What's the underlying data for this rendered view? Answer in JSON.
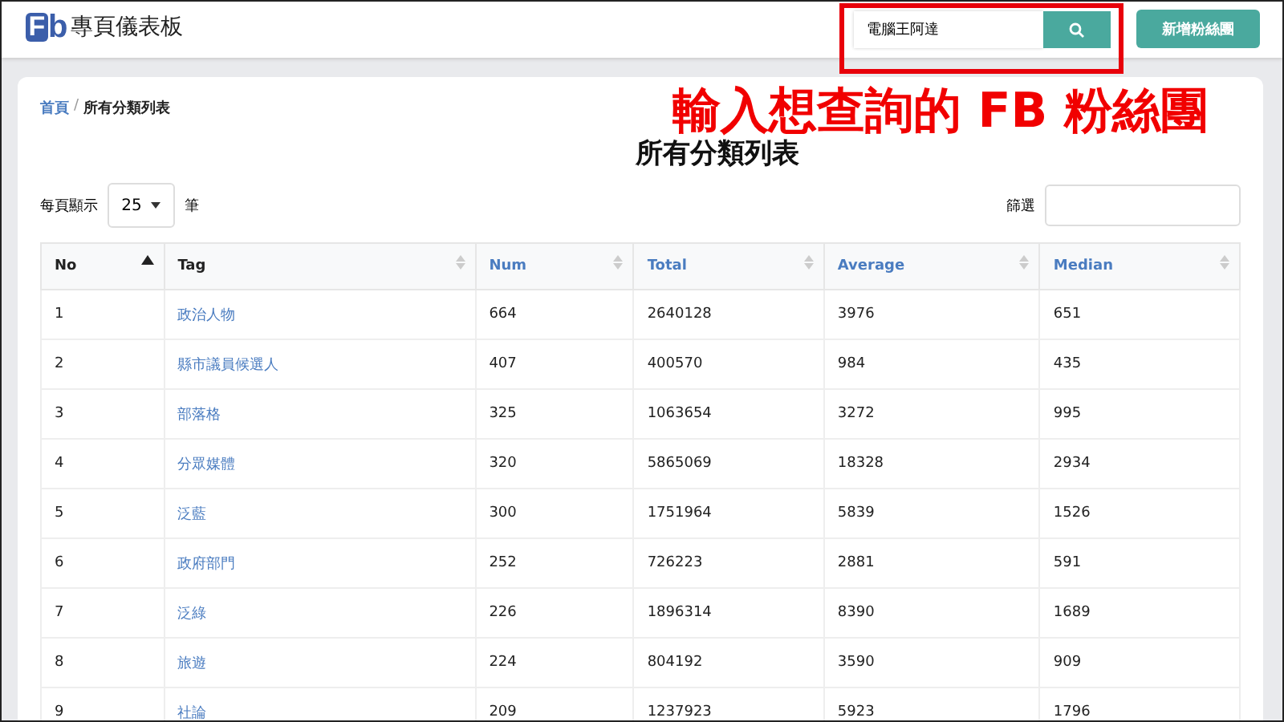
{
  "header": {
    "logo": {
      "letter_f": "F",
      "letter_b": "b"
    },
    "title": "專頁儀表板",
    "search": {
      "value": "電腦王阿達"
    },
    "add_button": "新增粉絲團"
  },
  "annotation": {
    "text": "輸入想查詢的 FB 粉絲團"
  },
  "breadcrumb_separator": "/",
  "breadcrumb": [
    {
      "label": "首頁",
      "link": true
    },
    {
      "label": "所有分類列表",
      "link": false
    }
  ],
  "page_title": "所有分類列表",
  "page_size": {
    "label_before": "每頁顯示",
    "value": "25",
    "label_after": "筆"
  },
  "filter": {
    "label": "篩選"
  },
  "table": {
    "columns": [
      {
        "label": "No",
        "sorted": true,
        "link": false
      },
      {
        "label": "Tag",
        "sorted": false,
        "link": false
      },
      {
        "label": "Num",
        "sorted": false,
        "link": true
      },
      {
        "label": "Total",
        "sorted": false,
        "link": true
      },
      {
        "label": "Average",
        "sorted": false,
        "link": true
      },
      {
        "label": "Median",
        "sorted": false,
        "link": true
      }
    ],
    "rows": [
      [
        "1",
        "政治人物",
        "664",
        "2640128",
        "3976",
        "651"
      ],
      [
        "2",
        "縣市議員候選人",
        "407",
        "400570",
        "984",
        "435"
      ],
      [
        "3",
        "部落格",
        "325",
        "1063654",
        "3272",
        "995"
      ],
      [
        "4",
        "分眾媒體",
        "320",
        "5865069",
        "18328",
        "2934"
      ],
      [
        "5",
        "泛藍",
        "300",
        "1751964",
        "5839",
        "1526"
      ],
      [
        "6",
        "政府部門",
        "252",
        "726223",
        "2881",
        "591"
      ],
      [
        "7",
        "泛綠",
        "226",
        "1896314",
        "8390",
        "1689"
      ],
      [
        "8",
        "旅遊",
        "224",
        "804192",
        "3590",
        "909"
      ],
      [
        "9",
        "社論",
        "209",
        "1237923",
        "5923",
        "1796"
      ]
    ]
  }
}
